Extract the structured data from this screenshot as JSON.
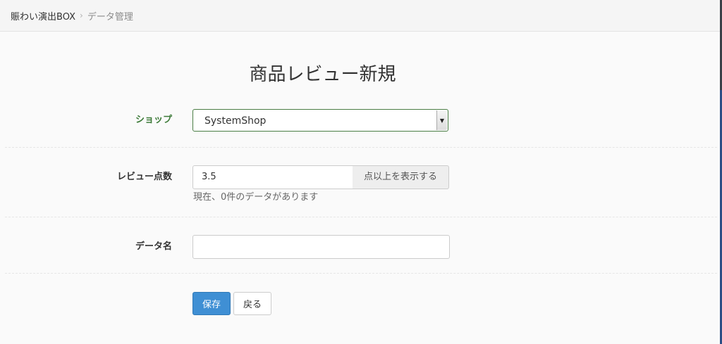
{
  "breadcrumb": {
    "home": "賑わい演出BOX",
    "separator": "›",
    "current": "データ管理"
  },
  "page": {
    "title": "商品レビュー新規"
  },
  "form": {
    "shop": {
      "label": "ショップ",
      "selected": "SystemShop",
      "arrow_icon": "▼"
    },
    "review_score": {
      "label": "レビュー点数",
      "value": "3.5",
      "addon": "点以上を表示する",
      "help": "現在、0件のデータがあります"
    },
    "data_name": {
      "label": "データ名",
      "value": ""
    }
  },
  "buttons": {
    "save": "保存",
    "back": "戻る"
  },
  "colors": {
    "primary": "#3f8fd4",
    "success": "#3c7a38"
  }
}
